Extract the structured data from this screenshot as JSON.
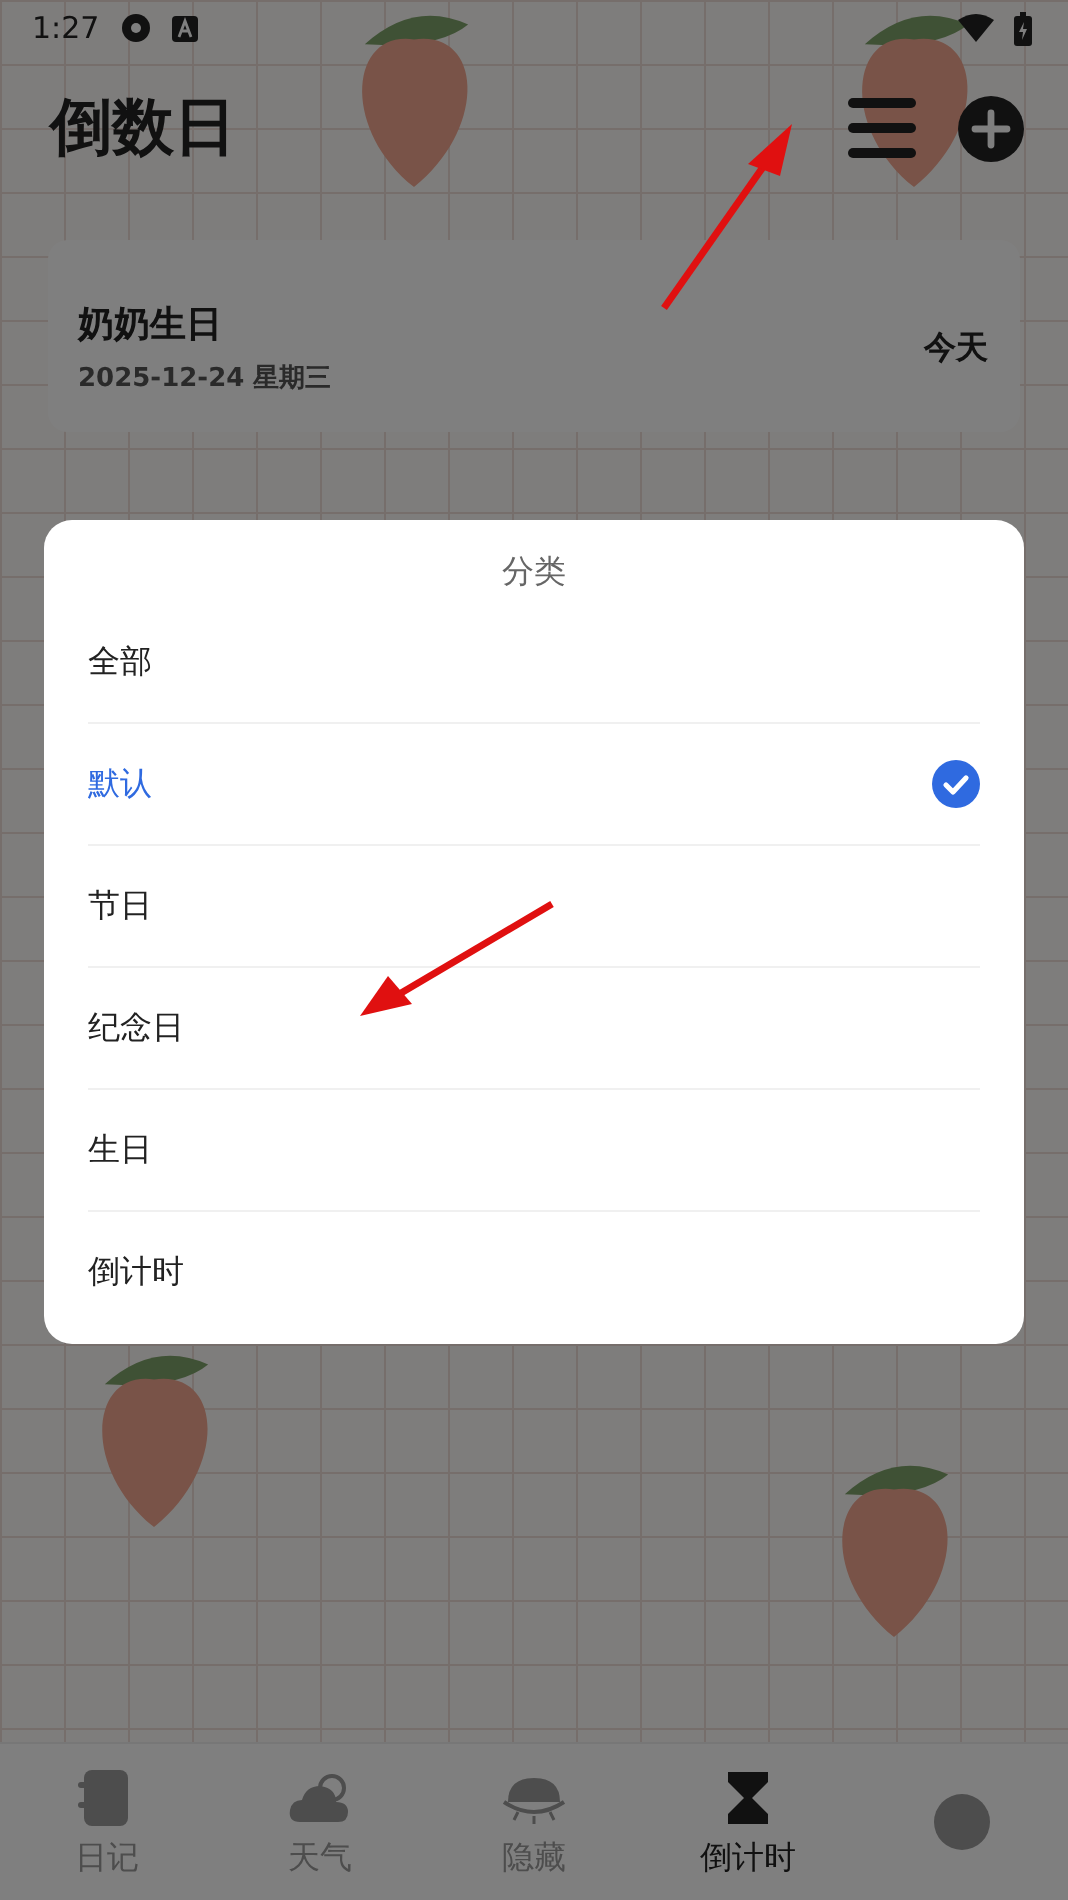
{
  "status_bar": {
    "time": "1:27"
  },
  "header": {
    "title": "倒数日"
  },
  "events": [
    {
      "name": "奶奶生日",
      "date": "2025-12-24 星期三",
      "countdown": "今天"
    }
  ],
  "dialog": {
    "title": "分类",
    "items": [
      {
        "label": "全部",
        "selected": false
      },
      {
        "label": "默认",
        "selected": true
      },
      {
        "label": "节日",
        "selected": false
      },
      {
        "label": "纪念日",
        "selected": false
      },
      {
        "label": "生日",
        "selected": false
      },
      {
        "label": "倒计时",
        "selected": false
      }
    ]
  },
  "bottom_nav": [
    {
      "kind": "diary",
      "label": "日记",
      "selected": false
    },
    {
      "kind": "weather",
      "label": "天气",
      "selected": false
    },
    {
      "kind": "hidden",
      "label": "隐藏",
      "selected": false
    },
    {
      "kind": "countdown",
      "label": "倒计时",
      "selected": true
    },
    {
      "kind": "profile",
      "selected": false
    }
  ],
  "annotations": [
    {
      "kind": "arrow"
    },
    {
      "kind": "arrow"
    }
  ]
}
